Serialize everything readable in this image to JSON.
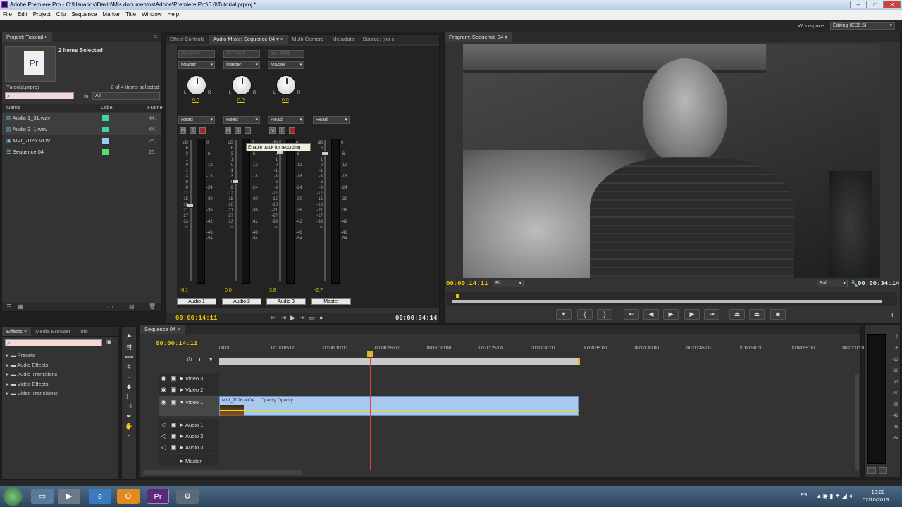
{
  "window": {
    "title": "Adobe Premiere Pro - C:\\Usuarios\\David\\Mis documentos\\Adobe\\Premiere Pro\\6.0\\Tutorial.prproj *"
  },
  "menu": [
    "File",
    "Edit",
    "Project",
    "Clip",
    "Sequence",
    "Marker",
    "Title",
    "Window",
    "Help"
  ],
  "workspace": {
    "label": "Workspace:",
    "value": "Editing (CS5.5)"
  },
  "project": {
    "tab": "Project: Tutorial",
    "selection_title": "2 Items Selected",
    "count": "2 of 4 items selected",
    "file": "Tutorial.prproj",
    "in_label": "In:",
    "in_value": "All",
    "col_name": "Name",
    "col_label": "Label",
    "col_frame": "Frame",
    "items": [
      {
        "name": "Audio 1_31.wav",
        "fr": "44.",
        "color": "#3fd5a8"
      },
      {
        "name": "Audio 3_1.wav",
        "fr": "44.",
        "color": "#3fd5a8"
      },
      {
        "name": "MVI_7026.MOV",
        "fr": "25,",
        "color": "#a0c8f0"
      },
      {
        "name": "Sequence 04",
        "fr": "25,",
        "color": "#50e070"
      }
    ]
  },
  "source_tabs": [
    "Effect Controls",
    "Audio Mixer: Sequence 04",
    "Multi-Camera",
    "Metadata",
    "Source: (no c"
  ],
  "mixer": {
    "in_label": "IN / IN/R",
    "master": "Master",
    "read": "Read",
    "tooltip": "Enable track for recording",
    "channels": [
      {
        "name": "Audio 1",
        "pan": "0,0",
        "level": "-6,1"
      },
      {
        "name": "Audio 2",
        "pan": "0,0",
        "level": "0,0"
      },
      {
        "name": "Audio 3",
        "pan": "0,0",
        "level": "3,8"
      },
      {
        "name": "Master",
        "pan": "",
        "level": "-2,7"
      }
    ],
    "current_time": "00:00:14:11",
    "duration": "00:00:34:14"
  },
  "program": {
    "tab": "Program: Sequence 04",
    "current_time": "00:00:14:11",
    "fit": "Fit",
    "quality": "Full",
    "duration": "00:00:34:14"
  },
  "effects": {
    "tabs": [
      "Effects",
      "Media Browser",
      "Info"
    ],
    "folders": [
      "Presets",
      "Audio Effects",
      "Audio Transitions",
      "Video Effects",
      "Video Transitions"
    ]
  },
  "timeline": {
    "tab": "Sequence 04",
    "current_time": "00:00:14:11",
    "ruler": [
      "00:00",
      "00:00:05:00",
      "00:00:10:00",
      "00:00:15:00",
      "00:00:20:00",
      "00:00:25:00",
      "00:00:30:00",
      "00:00:35:00",
      "00:00:40:00",
      "00:00:45:00",
      "00:00:50:00",
      "00:00:55:00",
      "00:01:00:0"
    ],
    "tracks": [
      "Video 3",
      "Video 2",
      "Video 1",
      "Audio 1",
      "Audio 2",
      "Audio 3",
      "Master"
    ],
    "clip_label": "MVI_7026.MOV",
    "clip_fx": "Opacity:Opacity"
  },
  "taskbar": {
    "lang": "ES",
    "time": "13:22",
    "date": "02/10/2013"
  }
}
